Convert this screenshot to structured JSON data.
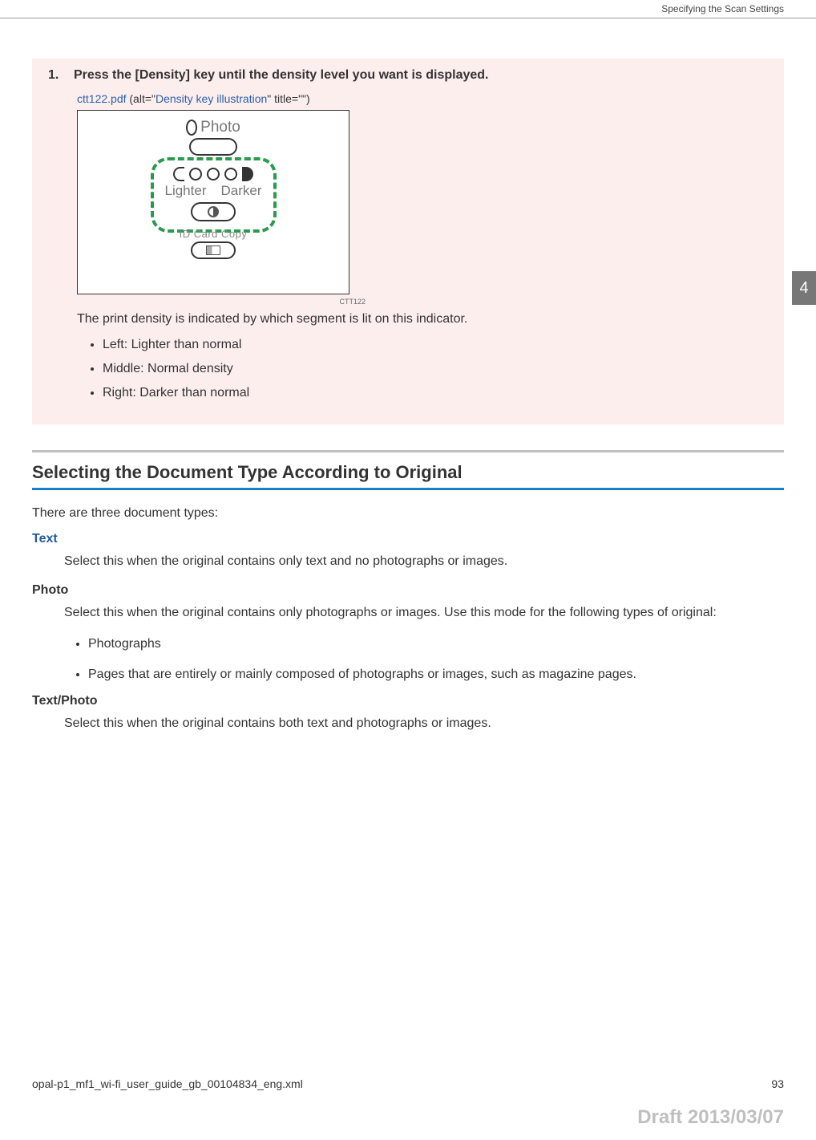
{
  "header": {
    "section": "Specifying the Scan Settings"
  },
  "step": {
    "number": "1.",
    "instruction": "Press the [Density] key until the density level you want is displayed.",
    "illus_ref": {
      "file": "ctt122.pdf",
      "open_paren": " (alt=\"",
      "alt": "Density key illustration",
      "close": "\" title=\"\")"
    },
    "illus": {
      "photo_label": "Photo",
      "lighter": "Lighter",
      "darker": "Darker",
      "idcard": "ID Card Copy",
      "caption": "CTT122"
    },
    "explain": "The print density is indicated by which segment is lit on this indicator.",
    "bullets": [
      "Left: Lighter than normal",
      "Middle: Normal density",
      "Right: Darker than normal"
    ]
  },
  "sidetab": "4",
  "section2": {
    "heading": "Selecting the Document Type According to Original",
    "intro": "There are three document types:",
    "items": [
      {
        "term": "Text",
        "color": "blue",
        "def": "Select this when the original contains only text and no photographs or images."
      },
      {
        "term": "Photo",
        "color": "normal",
        "def": "Select this when the original contains only photographs or images. Use this mode for the following types of original:",
        "subs": [
          "Photographs",
          "Pages that are entirely or mainly composed of photographs or images, such as magazine pages."
        ]
      },
      {
        "term": "Text/Photo",
        "color": "normal",
        "def": "Select this when the original contains both text and photographs or images."
      }
    ]
  },
  "footer": {
    "file": "opal-p1_mf1_wi-fi_user_guide_gb_00104834_eng.xml",
    "page": "93"
  },
  "watermark": "Draft 2013/03/07"
}
